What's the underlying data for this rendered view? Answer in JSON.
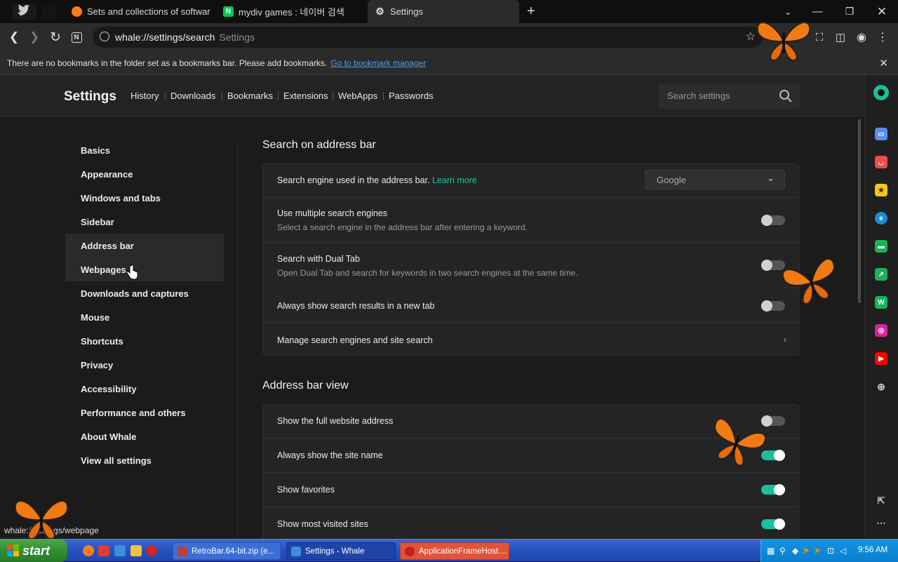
{
  "tabs": [
    {
      "label": "Sets and collections of softwar",
      "icon": "firefox-icon"
    },
    {
      "label": "mydiv games : 네이버 검색",
      "icon": "naver-icon"
    },
    {
      "label": "Settings",
      "icon": "gear-icon"
    }
  ],
  "omnibox": {
    "url": "whale://settings/search",
    "title": "Settings"
  },
  "bookmark_bar": {
    "message": "There are no bookmarks in the folder set as a bookmarks bar. Please add bookmarks.",
    "link": "Go to bookmark manager"
  },
  "settings_header": {
    "title": "Settings",
    "nav": [
      "History",
      "Downloads",
      "Bookmarks",
      "Extensions",
      "WebApps",
      "Passwords"
    ],
    "search_placeholder": "Search settings"
  },
  "menu": [
    "Basics",
    "Appearance",
    "Windows and tabs",
    "Sidebar",
    "Address bar",
    "Webpages",
    "Downloads and captures",
    "Mouse",
    "Shortcuts",
    "Privacy",
    "Accessibility",
    "Performance and others",
    "About Whale",
    "View all settings"
  ],
  "active_menu": "Address bar",
  "section1": {
    "title": "Search on address bar",
    "engine_label": "Search engine used in the address bar.",
    "learn_more": "Learn more",
    "engine_value": "Google",
    "rows": [
      {
        "label": "Use multiple search engines",
        "sub": "Select a search engine in the address bar after entering a keyword.",
        "on": false
      },
      {
        "label": "Search with Dual Tab",
        "sub": "Open Dual Tab and search for keywords in two search engines at the same time.",
        "on": false
      },
      {
        "label": "Always show search results in a new tab",
        "on": false
      }
    ],
    "manage_label": "Manage search engines and site search"
  },
  "section2": {
    "title": "Address bar view",
    "rows": [
      {
        "label": "Show the full website address",
        "on": false
      },
      {
        "label": "Always show the site name",
        "on": true
      },
      {
        "label": "Show favorites",
        "on": true
      },
      {
        "label": "Show most visited sites",
        "on": true
      }
    ]
  },
  "status_bar": "whale://settings/webpage",
  "taskbar": {
    "start": "start",
    "items": [
      "RetroBar.64-bit.zip (e...",
      "Settings - Whale",
      "ApplicationFrameHost...."
    ],
    "clock": "9:56 AM"
  },
  "colors": {
    "accent": "#1abf9b",
    "link": "#4a9df0",
    "taskbar": "#2452c0"
  }
}
